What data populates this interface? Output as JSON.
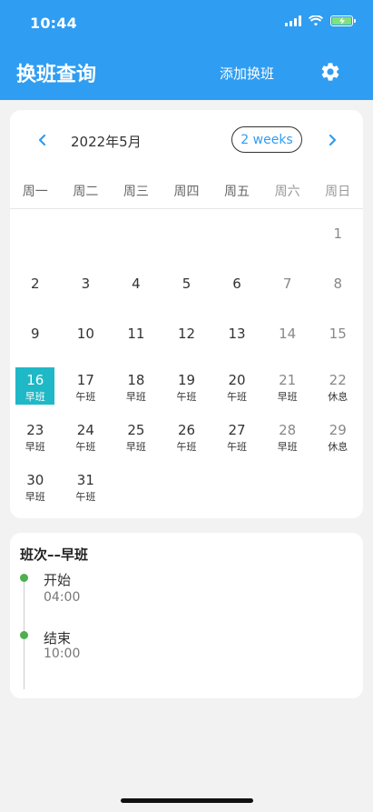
{
  "status_bar": {
    "time": "10:44"
  },
  "app_bar": {
    "title": "换班查询",
    "add_shift_label": "添加换班",
    "settings_icon": "gear-icon"
  },
  "calendar": {
    "month_label": "2022年5月",
    "format_button": "2 weeks",
    "weekdays": [
      "周一",
      "周二",
      "周三",
      "周四",
      "周五",
      "周六",
      "周日"
    ],
    "weeks": [
      [
        {
          "d": ""
        },
        {
          "d": ""
        },
        {
          "d": ""
        },
        {
          "d": ""
        },
        {
          "d": ""
        },
        {
          "d": ""
        },
        {
          "d": "1"
        }
      ],
      [
        {
          "d": "2"
        },
        {
          "d": "3"
        },
        {
          "d": "4"
        },
        {
          "d": "5"
        },
        {
          "d": "6"
        },
        {
          "d": "7"
        },
        {
          "d": "8"
        }
      ],
      [
        {
          "d": "9"
        },
        {
          "d": "10"
        },
        {
          "d": "11"
        },
        {
          "d": "12"
        },
        {
          "d": "13"
        },
        {
          "d": "14"
        },
        {
          "d": "15"
        }
      ],
      [
        {
          "d": "16",
          "s": "早班",
          "selected": true
        },
        {
          "d": "17",
          "s": "午班"
        },
        {
          "d": "18",
          "s": "早班"
        },
        {
          "d": "19",
          "s": "午班"
        },
        {
          "d": "20",
          "s": "午班"
        },
        {
          "d": "21",
          "s": "早班"
        },
        {
          "d": "22",
          "s": "休息"
        }
      ],
      [
        {
          "d": "23",
          "s": "早班"
        },
        {
          "d": "24",
          "s": "午班"
        },
        {
          "d": "25",
          "s": "早班"
        },
        {
          "d": "26",
          "s": "午班"
        },
        {
          "d": "27",
          "s": "午班"
        },
        {
          "d": "28",
          "s": "早班"
        },
        {
          "d": "29",
          "s": "休息"
        }
      ],
      [
        {
          "d": "30",
          "s": "早班"
        },
        {
          "d": "31",
          "s": "午班"
        },
        {
          "d": ""
        },
        {
          "d": ""
        },
        {
          "d": ""
        },
        {
          "d": ""
        },
        {
          "d": ""
        }
      ]
    ]
  },
  "shift_detail": {
    "title": "班次––早班",
    "start_label": "开始",
    "start_time": "04:00",
    "end_label": "结束",
    "end_time": "10:00"
  },
  "colors": {
    "primary": "#2f9df2",
    "selected": "#1fb8c6",
    "timeline_dot": "#4caf50"
  }
}
